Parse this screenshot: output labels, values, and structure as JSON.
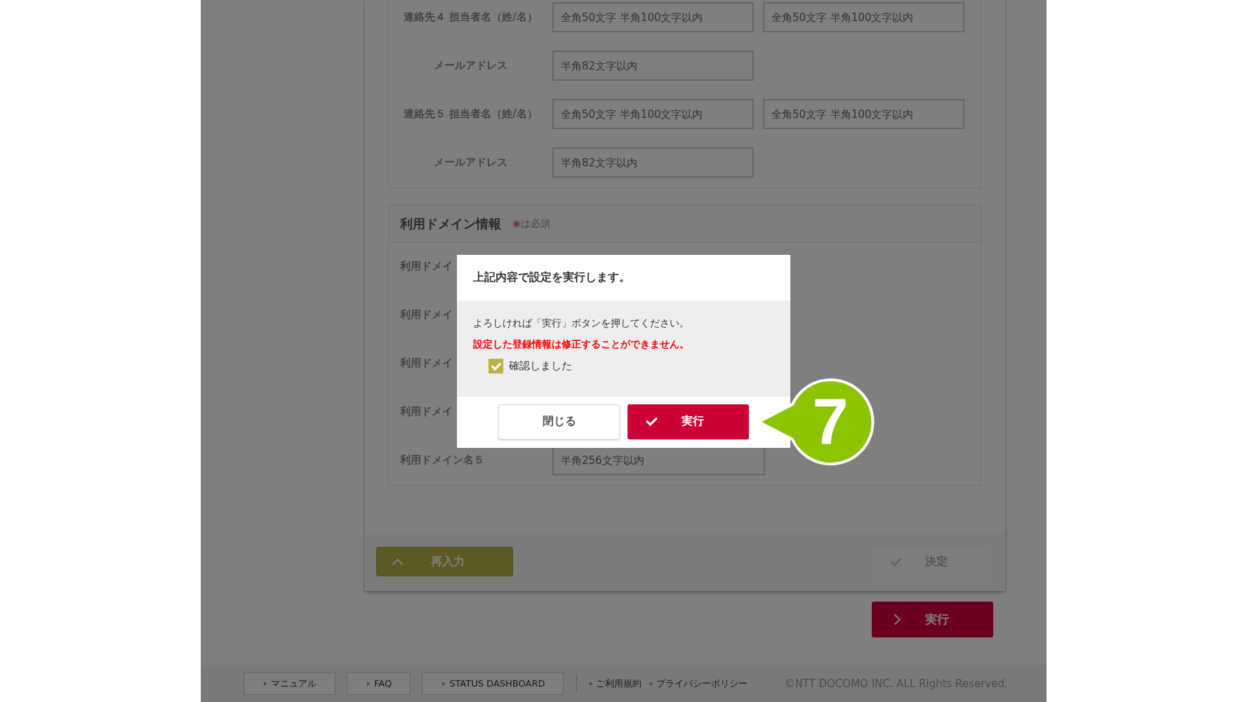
{
  "contacts": [
    {
      "label": "連絡先４ 担当者名（姓/名）",
      "fields": [
        {
          "placeholder": "全角50文字 半角100文字以内"
        },
        {
          "placeholder": "全角50文字 半角100文字以内"
        }
      ]
    },
    {
      "label": "メールアドレス",
      "fields": [
        {
          "placeholder": "半角82文字以内"
        }
      ]
    },
    {
      "label": "連絡先５ 担当者名（姓/名）",
      "fields": [
        {
          "placeholder": "全角50文字 半角100文字以内"
        },
        {
          "placeholder": "全角50文字 半角100文字以内"
        }
      ]
    },
    {
      "label": "メールアドレス",
      "fields": [
        {
          "placeholder": "半角82文字以内"
        }
      ]
    }
  ],
  "domain_section": {
    "title": "利用ドメイン情報",
    "required_mark": "※",
    "required_note": "は必須",
    "rows": [
      {
        "label": "利用ドメイ",
        "fields": []
      },
      {
        "label": "利用ドメイ",
        "fields": []
      },
      {
        "label": "利用ドメイ",
        "fields": []
      },
      {
        "label": "利用ドメイ",
        "fields": []
      },
      {
        "label": "利用ドメイン名５",
        "fields": [
          {
            "placeholder": "半角256文字以内"
          }
        ]
      }
    ]
  },
  "card_buttons": [
    {
      "label": "再入力",
      "kind": "back",
      "disabled": false
    },
    {
      "label": "決定",
      "kind": "confirm",
      "disabled": true
    }
  ],
  "submit_button": {
    "label": "実行"
  },
  "footer": {
    "links": [
      {
        "label": "マニュアル",
        "kind": "boxed"
      },
      {
        "label": "FAQ",
        "kind": "boxed"
      },
      {
        "label": "STATUS DASHBOARD",
        "kind": "boxed"
      },
      {
        "label": "ご利用規約",
        "kind": "plain"
      },
      {
        "label": "プライバシーポリシー",
        "kind": "plain"
      }
    ],
    "copyright": "©NTT DOCOMO INC. ALL Rights Reserved."
  },
  "modal": {
    "title": "上記内容で設定を実行します。",
    "message": "よろしければ「実行」ボタンを押してください。",
    "warning": "設定した登録情報は修正することができません。",
    "checkbox": {
      "label": "確認しました",
      "checked": true
    },
    "buttons": [
      {
        "label": "閉じる",
        "kind": "close"
      },
      {
        "label": "実行",
        "kind": "execute"
      }
    ]
  },
  "callout": {
    "label": "7"
  }
}
